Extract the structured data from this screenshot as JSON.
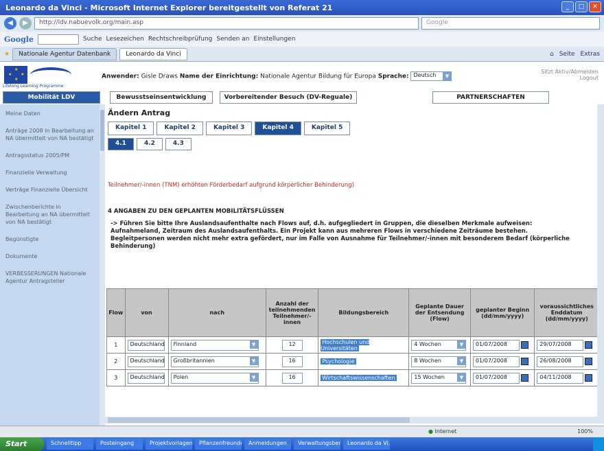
{
  "window": {
    "title": "Leonardo da Vinci - Microsoft Internet Explorer bereitgestellt von Referat 21"
  },
  "addressbar": {
    "url": "http://ldv.nabuevolk.org/main.asp",
    "search_placeholder": "Google"
  },
  "google_toolbar": {
    "logo": "Google",
    "items": [
      "Suche",
      "Lesezeichen",
      "Rechtschreibprüfung",
      "Senden an",
      "Einstellungen"
    ]
  },
  "browser_tabs": [
    "Nationale Agentur Datenbank",
    "Leonardo da Vinci"
  ],
  "toolbar_right": [
    "Seite",
    "Extras"
  ],
  "header": {
    "anwender_label": "Anwender:",
    "anwender_value": "Gisle Draws",
    "einrichtung_label": "Name der Einrichtung:",
    "einrichtung_value": "Nationale Agentur Bildung für Europa",
    "sprache_label": "Sprache:",
    "sprache_value": "Deutsch",
    "right_text_1": "Sitzt Aktiv/Abmelden",
    "right_text_2": "Logout",
    "eu_caption": "Lifelong Learning Programme"
  },
  "main_tabs": [
    "Mobilität LDV",
    "Bewusstseinsentwicklung",
    "Vorbereitender Besuch (DV-Reguale)",
    "PARTNERSCHAFTEN"
  ],
  "leftnav": [
    "Meine Daten",
    "Anträge 2008 in Bearbeitung an NA übermittelt von NA bestätigt",
    "Antragsstatus 2005/PM",
    "Finanzielle Verwaltung",
    "Verträge Finanzielle Übersicht",
    "Zwischenberichte in Bearbeitung an NA übermittelt von NA bestätigt",
    "Begünstigte",
    "Dokumente",
    "VERBESSERUNGEN Nationale Agentur Antragsteller"
  ],
  "content": {
    "title": "Ändern Antrag",
    "kapitel": [
      "Kapitel 1",
      "Kapitel 2",
      "Kapitel 3",
      "Kapitel 4",
      "Kapitel 5"
    ],
    "kapitel_active": "Kapitel 4",
    "sub_tabs": [
      "4.1",
      "4.2",
      "4.3"
    ],
    "sub_active": "4.1",
    "warning": "Teilnehmer/-innen (TNM) erhöhten Förderbedarf aufgrund körperlicher Behinderung)",
    "section_title": "4 ANGABEN ZU DEN GEPLANTEN MOBILITÄTSFLÜSSEN",
    "section_text": "-> Führen Sie bitte Ihre Auslandsaufenthalte nach Flows auf, d.h. aufgegliedert in Gruppen, die dieselben Merkmale aufweisen: Aufnahmeland, Zeitraum des Auslandsaufenthalts. Ein Projekt kann aus mehreren Flows in verschiedene Zeiträume bestehen. Begleitpersonen werden nicht mehr extra gefördert, nur im Falle von Ausnahme für Teilnehmer/-innen mit besonderem Bedarf (körperliche Behinderung)"
  },
  "table": {
    "headers": [
      "Flow",
      "von",
      "nach",
      "Anzahl der teilnehmenden Teilnehmer/-innen",
      "Bildungsbereich",
      "Geplante Dauer der Entsendung (Flow)",
      "geplanter Beginn (dd/mm/yyyy)",
      "voraussichtliches Enddatum (dd/mm/yyyy)"
    ],
    "rows": [
      {
        "flow": "1",
        "von": "Deutschland",
        "nach": "Finnland",
        "anzahl": "12",
        "bildung": "Hochschulen und Universitäten",
        "dauer": "4 Wochen",
        "beginn": "01/07/2008",
        "ende": "29/07/2008"
      },
      {
        "flow": "2",
        "von": "Deutschland",
        "nach": "Großbritannien",
        "anzahl": "16",
        "bildung": "Psychologie",
        "dauer": "8 Wochen",
        "beginn": "01/07/2008",
        "ende": "26/08/2008"
      },
      {
        "flow": "3",
        "von": "Deutschland",
        "nach": "Polen",
        "anzahl": "16",
        "bildung": "Wirtschaftswissenschaften",
        "dauer": "15 Wochen",
        "beginn": "01/07/2008",
        "ende": "04/11/2008"
      }
    ]
  },
  "status": {
    "zone": "Internet",
    "zoom": "100%"
  },
  "taskbar": {
    "start": "Start",
    "items": [
      "Schnelltipp",
      "Posteingang",
      "Projektvorlagen",
      "Pflanzenfreunde",
      "Anmeldungen",
      "Verwaltungsbericht",
      "Leonardo da Vi..."
    ]
  }
}
